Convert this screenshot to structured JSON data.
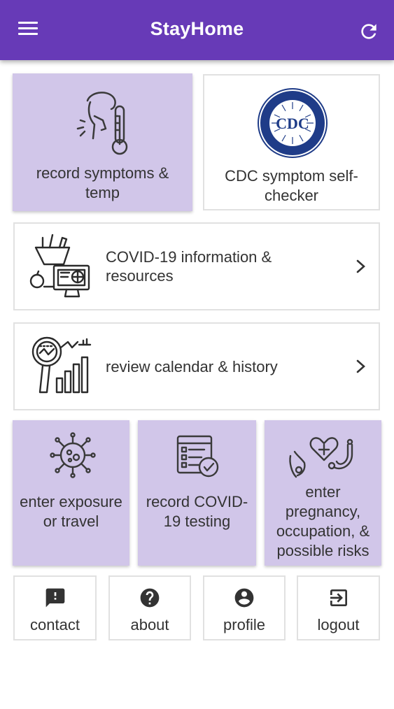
{
  "header": {
    "title": "StayHome",
    "menu_icon": "hamburger-menu-icon",
    "refresh_icon": "refresh-icon"
  },
  "tiles": {
    "record_symptoms": {
      "label": "record symptoms & temp",
      "icon": "sick-person-thermometer-icon"
    },
    "cdc_checker": {
      "label": "CDC symptom self-checker",
      "icon": "cdc-logo",
      "logo_text": "CDC",
      "seal_text": "CENTERS FOR DISEASE CONTROL AND PREVENTION"
    },
    "covid_info": {
      "label": "COVID-19 information & resources",
      "icon": "groceries-computer-icon"
    },
    "review_calendar": {
      "label": "review calendar & history",
      "icon": "magnifier-chart-icon"
    },
    "exposure": {
      "label": "enter exposure or travel",
      "icon": "virus-icon"
    },
    "testing": {
      "label": "record COVID-19 testing",
      "icon": "checklist-icon"
    },
    "pregnancy": {
      "label": "enter pregnancy, occupation, & possible risks",
      "icon": "heart-stethoscope-icon"
    }
  },
  "bottom": {
    "contact": "contact",
    "about": "about",
    "profile": "profile",
    "logout": "logout"
  },
  "colors": {
    "appbar": "#673ab7",
    "tile_purple": "#d1c6e9",
    "icon_dark": "#2b2b2b",
    "cdc_blue": "#1f3c88"
  }
}
